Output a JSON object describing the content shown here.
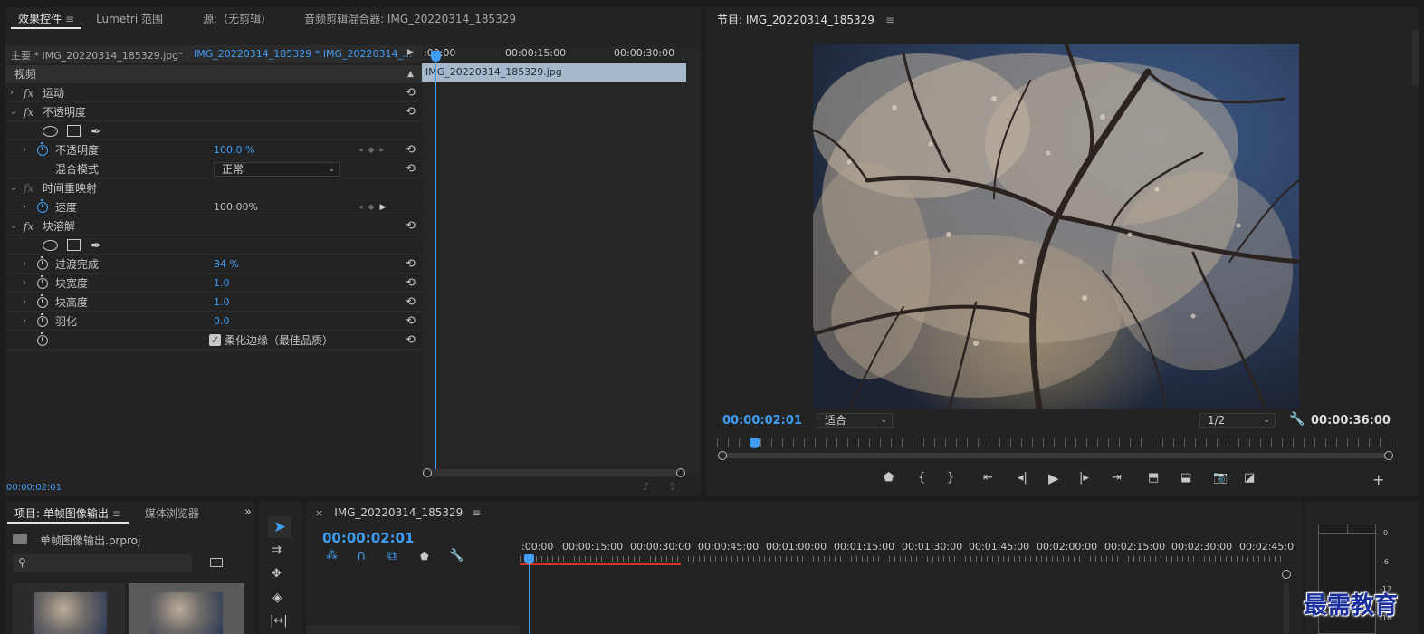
{
  "effect_controls": {
    "tabs": [
      {
        "label": "效果控件",
        "active": true
      },
      {
        "label": "Lumetri 范围"
      },
      {
        "label": "源:（无剪辑）"
      },
      {
        "label": "音频剪辑混合器: IMG_20220314_185329"
      }
    ],
    "menu_glyph": "≡",
    "master_clip": "主要 * IMG_20220314_185329.jpg",
    "sequence_clip": "IMG_20220314_185329 * IMG_20220314_...",
    "section_video": "视频",
    "fx_symbol": "fx",
    "rows": {
      "motion": "运动",
      "opacity_group": "不透明度",
      "opacity": "不透明度",
      "opacity_value": "100.0 %",
      "blend_mode": "混合模式",
      "blend_mode_value": "正常",
      "time_remap": "时间重映射",
      "speed": "速度",
      "speed_value": "100.00%",
      "block_dissolve": "块溶解",
      "transition_completion": "过渡完成",
      "transition_completion_value": "34 %",
      "block_width": "块宽度",
      "block_width_value": "1.0",
      "block_height": "块高度",
      "block_height_value": "1.0",
      "feather": "羽化",
      "feather_value": "0.0",
      "soft_edges": "柔化边缘（最佳品质）",
      "soft_edges_checked": true
    },
    "mini_timeline": {
      "ticks": [
        ":00:00",
        "00:00:15:00",
        "00:00:30:00"
      ],
      "clip_name": "IMG_20220314_185329.jpg"
    },
    "current_time": "00:00:02:01"
  },
  "program_monitor": {
    "title": "节目: IMG_20220314_185329",
    "timecode": "00:00:02:01",
    "fit": "适合",
    "resolution": "1/2",
    "duration": "00:00:36:00"
  },
  "project": {
    "tabs": [
      {
        "label": "项目: 单帧图像输出",
        "active": true
      },
      {
        "label": "媒体浏览器"
      }
    ],
    "overflow": "»",
    "project_file": "单帧图像输出.prproj",
    "search_placeholder": ""
  },
  "timeline": {
    "close": "×",
    "sequence_name": "IMG_20220314_185329",
    "timecode": "00:00:02:01",
    "ticks": [
      ":00:00",
      "00:00:15:00",
      "00:00:30:00",
      "00:00:45:00",
      "00:01:00:00",
      "00:01:15:00",
      "00:01:30:00",
      "00:01:45:00",
      "00:02:00:00",
      "00:02:15:00",
      "00:02:30:00",
      "00:02:45:0"
    ]
  },
  "audio_meter": {
    "labels": [
      "0",
      "-6",
      "-12",
      "-18"
    ]
  },
  "watermark": "最需教育",
  "colors": {
    "accent_blue": "#3f9ef5",
    "panel_bg": "#232323",
    "app_bg": "#1d1d1d",
    "work_area_red": "#d9342b"
  }
}
